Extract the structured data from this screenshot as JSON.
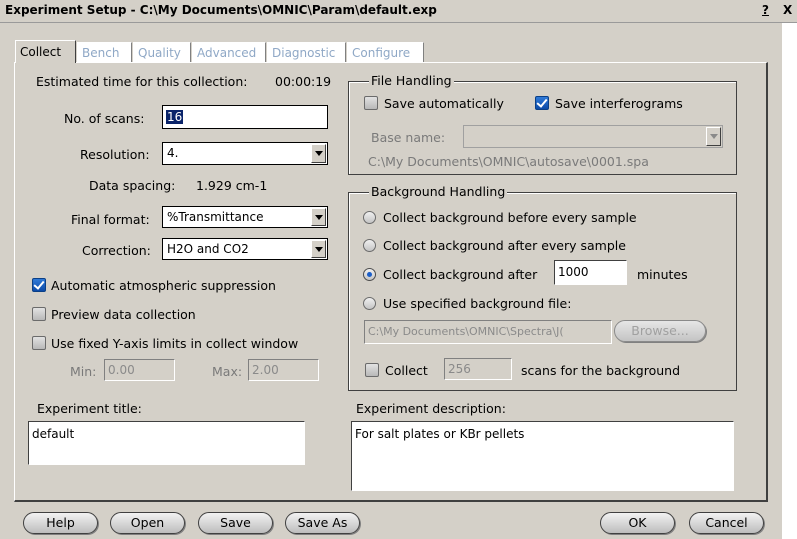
{
  "window": {
    "title": "Experiment Setup - C:\\My Documents\\OMNIC\\Param\\default.exp",
    "help_glyph": "?",
    "close_glyph": "X"
  },
  "tabs": [
    {
      "label": "Collect",
      "active": true
    },
    {
      "label": "Bench",
      "active": false
    },
    {
      "label": "Quality",
      "active": false
    },
    {
      "label": "Advanced",
      "active": false
    },
    {
      "label": "Diagnostic",
      "active": false
    },
    {
      "label": "Configure",
      "active": false
    }
  ],
  "collect": {
    "estimated_label": "Estimated time for this collection:",
    "estimated_value": "00:00:19",
    "scans_label": "No. of scans:",
    "scans_value": "16",
    "resolution_label": "Resolution:",
    "resolution_value": "4.",
    "spacing_label": "Data spacing:",
    "spacing_value": "1.929 cm-1",
    "format_label": "Final format:",
    "format_value": "%Transmittance",
    "correction_label": "Correction:",
    "correction_value": "H2O and CO2",
    "atmos_label": "Automatic atmospheric suppression",
    "atmos_checked": true,
    "preview_label": "Preview data collection",
    "preview_checked": false,
    "fixed_y_label": "Use fixed Y-axis limits in collect window",
    "fixed_y_checked": false,
    "min_label": "Min:",
    "min_value": "0.00",
    "max_label": "Max:",
    "max_value": "2.00",
    "exp_title_label": "Experiment title:",
    "exp_title_value": "default"
  },
  "file_handling": {
    "group_label": "File Handling",
    "save_auto_label": "Save automatically",
    "save_auto_checked": false,
    "save_ifg_label": "Save interferograms",
    "save_ifg_checked": true,
    "base_name_label": "Base name:",
    "base_name_value": "",
    "path": "C:\\My Documents\\OMNIC\\autosave\\0001.spa"
  },
  "background": {
    "group_label": "Background Handling",
    "opt1": "Collect background before every sample",
    "opt2": "Collect background after every sample",
    "opt3_prefix": "Collect background after",
    "opt3_value": "1000",
    "opt3_suffix": "minutes",
    "opt4": "Use specified background file:",
    "selected_option": 3,
    "file_value": "C:\\My Documents\\OMNIC\\Spectra\\J(",
    "browse_label": "Browse...",
    "collect_label": "Collect",
    "collect_checked": false,
    "collect_value": "256",
    "collect_suffix": "scans for the background"
  },
  "description": {
    "label": "Experiment description:",
    "value": "For salt plates or KBr pellets"
  },
  "buttons": {
    "help": "Help",
    "open": "Open",
    "save": "Save",
    "save_as": "Save As",
    "ok": "OK",
    "cancel": "Cancel"
  }
}
